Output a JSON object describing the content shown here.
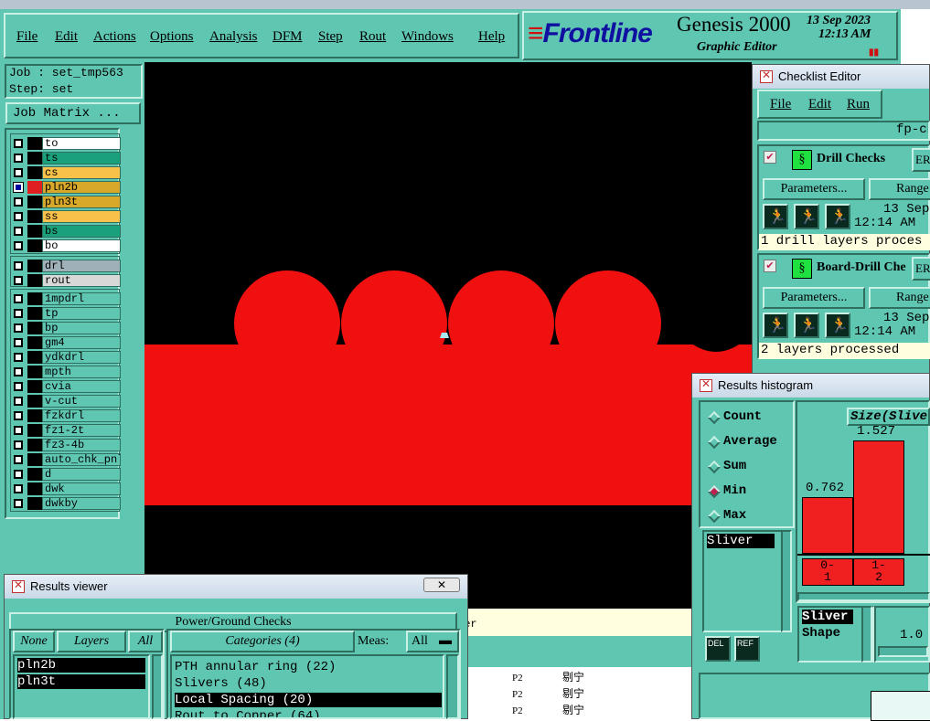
{
  "app": {
    "logo": "Frontline",
    "product": "Genesis 2000",
    "subtitle": "Graphic Editor",
    "date": "13 Sep 2023",
    "time": "12:13 AM"
  },
  "menu": [
    "File",
    "Edit",
    "Actions",
    "Options",
    "Analysis",
    "DFM",
    "Step",
    "Rout",
    "Windows",
    "Help"
  ],
  "job": {
    "job_line": "Job : set_tmp563",
    "step_line": "Step: set",
    "matrix_button": "Job Matrix ..."
  },
  "layers": {
    "board": [
      {
        "name": "to",
        "color": "#ffffff",
        "checked": false
      },
      {
        "name": "ts",
        "color": "#1aa07a",
        "checked": false
      },
      {
        "name": "cs",
        "color": "#f7c14a",
        "checked": false
      },
      {
        "name": "pln2b",
        "color": "#d8a82a",
        "checked": true
      },
      {
        "name": "pln3t",
        "color": "#d8a82a",
        "checked": false
      },
      {
        "name": "ss",
        "color": "#f7c14a",
        "checked": false
      },
      {
        "name": "bs",
        "color": "#1aa07a",
        "checked": false
      },
      {
        "name": "bo",
        "color": "#ffffff",
        "checked": false
      }
    ],
    "drill": [
      {
        "name": "drl",
        "color": "#a0b0b8",
        "checked": false
      },
      {
        "name": "rout",
        "color": "#d8d8d8",
        "checked": false
      }
    ],
    "misc": [
      "1mpdrl",
      "tp",
      "bp",
      "gm4",
      "ydkdrl",
      "mpth",
      "cvia",
      "v-cut",
      "fzkdrl",
      "fz1-2t",
      "fz3-4b",
      "auto_chk_pnl",
      "d",
      "dwk",
      "dwkby"
    ]
  },
  "status_strip": {
    "text": "mer"
  },
  "bg_table": {
    "rows": [
      [
        "P2",
        "剔宁"
      ],
      [
        "P2",
        "剔宁"
      ],
      [
        "P2",
        "剔宁"
      ]
    ]
  },
  "results_viewer": {
    "window_title": "Results viewer",
    "check_title": "Power/Ground Checks",
    "none_btn": "None",
    "layers_btn": "Layers",
    "all_btn": "All",
    "categories_btn": "Categories (4)",
    "meas_label": "Meas:",
    "meas_value": "All",
    "layer_items": [
      "pln2b",
      "pln3t"
    ],
    "category_items": [
      "PTH annular ring (22)",
      "Slivers (48)",
      "Local Spacing (20)",
      "Rout to Copper (64)"
    ]
  },
  "checklist_editor": {
    "window_title": "Checklist Editor",
    "menu": [
      "File",
      "Edit",
      "Run"
    ],
    "name": "fp-ch",
    "checks": [
      {
        "title": "Drill Checks",
        "erf": "ER",
        "params": "Parameters...",
        "range": "Range",
        "date": "13 Sep",
        "time": "12:14 AM",
        "status": "1 drill layers proces"
      },
      {
        "title": "Board-Drill Che",
        "erf": "ER",
        "params": "Parameters...",
        "range": "Range",
        "date": "13 Sep",
        "time": "12:14 AM",
        "status": "2 layers processed"
      }
    ]
  },
  "histogram": {
    "window_title": "Results histogram",
    "options": [
      "Count",
      "Average",
      "Sum",
      "Min",
      "Max"
    ],
    "selected": "Min",
    "header": "Size(Sliver",
    "list_items": [
      "Sliver"
    ],
    "bars": [
      {
        "label": "0-\n1",
        "value": 0.762
      },
      {
        "label": "1-\n2",
        "value": 1.527
      }
    ],
    "shape_list": [
      "Sliver",
      "Shape"
    ],
    "scale_value": "1.0",
    "del_btn": "DEL",
    "ref_btn": "REF"
  },
  "colors": {
    "panel": "#5fc6b2",
    "canvas": "#000000",
    "feature": "#f01010"
  }
}
